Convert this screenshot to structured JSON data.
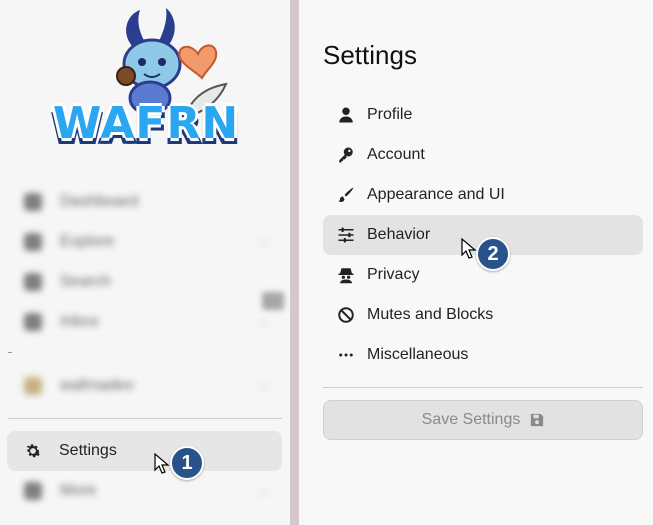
{
  "logo": {
    "text": "WAFRN"
  },
  "sidebar": {
    "items": [
      {
        "label": "Dashboard",
        "icon": "home-icon"
      },
      {
        "label": "Explore",
        "icon": "compass-icon",
        "chevron": "›"
      },
      {
        "label": "Search",
        "icon": "search-icon"
      },
      {
        "label": "Inbox",
        "icon": "inbox-icon",
        "chevron": "›"
      },
      {
        "label": "wafrnadev",
        "icon": "avatar-icon",
        "chevron": "›"
      }
    ],
    "settings_label": "Settings",
    "more_label": "More",
    "more_chevron": "›"
  },
  "settings": {
    "title": "Settings",
    "menu": [
      {
        "label": "Profile",
        "icon": "user-icon"
      },
      {
        "label": "Account",
        "icon": "key-icon"
      },
      {
        "label": "Appearance and UI",
        "icon": "paintbrush-icon"
      },
      {
        "label": "Behavior",
        "icon": "sliders-icon",
        "active": true
      },
      {
        "label": "Privacy",
        "icon": "spy-icon"
      },
      {
        "label": "Mutes and Blocks",
        "icon": "ban-icon"
      },
      {
        "label": "Miscellaneous",
        "icon": "ellipsis-icon"
      }
    ],
    "save_label": "Save Settings"
  },
  "annotations": {
    "badge1": "1",
    "badge2": "2"
  },
  "colors": {
    "badge": "#27528a",
    "active_item": "#e3e3e3",
    "split_bar": "#d4c8cc",
    "logo_blue": "#2aa7f0"
  }
}
